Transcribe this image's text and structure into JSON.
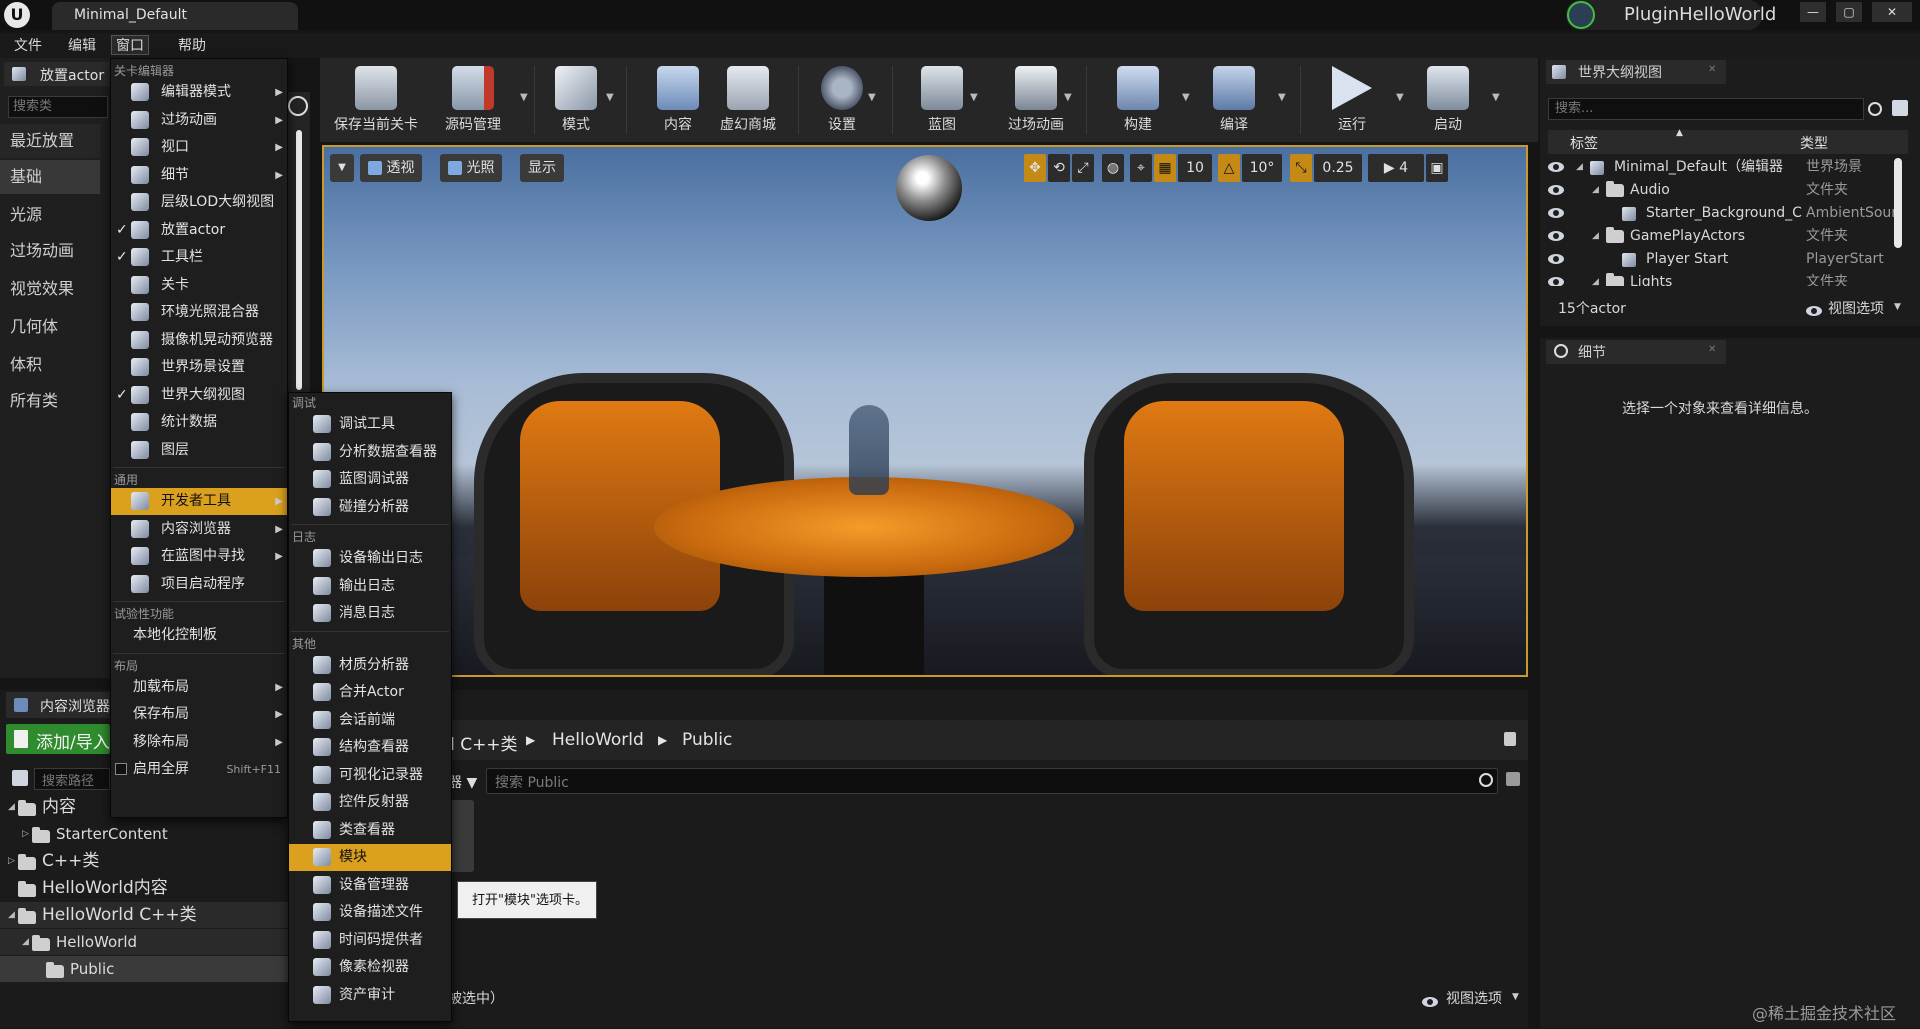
{
  "window": {
    "tab_title": "Minimal_Default",
    "project_name": "PluginHelloWorld",
    "controls": [
      "—",
      "▢",
      "✕"
    ]
  },
  "menubar": {
    "items": [
      {
        "label": "文件"
      },
      {
        "label": "编辑"
      },
      {
        "label": "窗口"
      },
      {
        "label": "帮助"
      }
    ]
  },
  "place_panel": {
    "tab_label": "放置actor",
    "search_placeholder": "搜索类",
    "categories": [
      "最近放置",
      "基础",
      "光源",
      "过场动画",
      "视觉效果",
      "几何体",
      "体积",
      "所有类"
    ]
  },
  "toolbar": {
    "buttons": [
      {
        "label": "保存当前关卡",
        "icon": "save-icon"
      },
      {
        "label": "源码管理",
        "icon": "source-control-icon"
      },
      {
        "label": "模式",
        "icon": "modes-icon"
      },
      {
        "label": "内容",
        "icon": "content-icon"
      },
      {
        "label": "虚幻商城",
        "icon": "marketplace-icon"
      },
      {
        "label": "设置",
        "icon": "settings-icon"
      },
      {
        "label": "蓝图",
        "icon": "blueprint-icon"
      },
      {
        "label": "过场动画",
        "icon": "cinematics-icon"
      },
      {
        "label": "构建",
        "icon": "build-icon"
      },
      {
        "label": "编译",
        "icon": "compile-icon"
      },
      {
        "label": "运行",
        "icon": "play-icon"
      },
      {
        "label": "启动",
        "icon": "launch-icon"
      }
    ]
  },
  "viewport": {
    "perspective": "透视",
    "lit": "光照",
    "show": "显示",
    "grid_snap": "10",
    "rotation_snap": "10°",
    "scale_snap": "0.25",
    "camera_speed": "4"
  },
  "outliner": {
    "tab_label": "世界大纲视图",
    "search_placeholder": "搜索...",
    "col_label": "标签",
    "col_type": "类型",
    "rows": [
      {
        "label": "Minimal_Default（编辑器",
        "type": "世界场景",
        "indent": 0
      },
      {
        "label": "Audio",
        "type": "文件夹",
        "indent": 1
      },
      {
        "label": "Starter_Background_C",
        "type": "AmbientSoun",
        "indent": 2
      },
      {
        "label": "GamePlayActors",
        "type": "文件夹",
        "indent": 1
      },
      {
        "label": "Player Start",
        "type": "PlayerStart",
        "indent": 2
      },
      {
        "label": "Lights",
        "type": "文件夹",
        "indent": 1
      }
    ],
    "actor_count": "15个actor",
    "view_options": "视图选项"
  },
  "details": {
    "tab_label": "细节",
    "empty_message": "选择一个对象来查看详细信息。"
  },
  "content_browser": {
    "tab_label": "内容浏览器",
    "add_import": "添加/导入",
    "path_search_placeholder": "搜索路径",
    "crumbs": [
      "d C++类",
      "HelloWorld",
      "Public"
    ],
    "search_placeholder": "搜索 Public",
    "tree": [
      {
        "label": "内容",
        "indent": 0,
        "kind": "folder"
      },
      {
        "label": "StarterContent",
        "indent": 1,
        "kind": "folder"
      },
      {
        "label": "C++类",
        "indent": 0,
        "kind": "cpp"
      },
      {
        "label": "HelloWorld内容",
        "indent": 0,
        "kind": "folder"
      },
      {
        "label": "HelloWorld C++类",
        "indent": 0,
        "kind": "cpp"
      },
      {
        "label": "HelloWorld",
        "indent": 1,
        "kind": "cpp"
      },
      {
        "label": "Public",
        "indent": 2,
        "kind": "cpp"
      }
    ],
    "status_text": "被选中）",
    "view_options": "视图选项"
  },
  "window_menu": {
    "sections": [
      {
        "heading": "关卡编辑器",
        "items": [
          {
            "label": "编辑器模式",
            "icon": "editor-modes-icon",
            "checked": false,
            "submenu": true
          },
          {
            "label": "过场动画",
            "icon": "cinematics-icon",
            "checked": false,
            "submenu": true
          },
          {
            "label": "视口",
            "icon": "viewport-icon",
            "checked": false,
            "submenu": true
          },
          {
            "label": "细节",
            "icon": "details-icon",
            "checked": false,
            "submenu": true
          },
          {
            "label": "层级LOD大纲视图",
            "icon": "hlod-icon",
            "checked": false,
            "submenu": false
          },
          {
            "label": "放置actor",
            "icon": "place-actor-icon",
            "checked": true,
            "submenu": false
          },
          {
            "label": "工具栏",
            "icon": "toolbar-icon",
            "checked": true,
            "submenu": false
          },
          {
            "label": "关卡",
            "icon": "levels-icon",
            "checked": false,
            "submenu": false
          },
          {
            "label": "环境光照混合器",
            "icon": "env-light-mixer-icon",
            "checked": false,
            "submenu": false
          },
          {
            "label": "摄像机晃动预览器",
            "icon": "camera-shake-icon",
            "checked": false,
            "submenu": false
          },
          {
            "label": "世界场景设置",
            "icon": "world-settings-icon",
            "checked": false,
            "submenu": false
          },
          {
            "label": "世界大纲视图",
            "icon": "world-outliner-icon",
            "checked": true,
            "submenu": false
          },
          {
            "label": "统计数据",
            "icon": "statistics-icon",
            "checked": false,
            "submenu": false
          },
          {
            "label": "图层",
            "icon": "layers-icon",
            "checked": false,
            "submenu": false
          }
        ]
      },
      {
        "heading": "通用",
        "items": [
          {
            "label": "开发者工具",
            "icon": "developer-tools-icon",
            "checked": false,
            "submenu": true,
            "highlighted": true
          },
          {
            "label": "内容浏览器",
            "icon": "content-browser-icon",
            "checked": false,
            "submenu": true
          },
          {
            "label": "在蓝图中寻找",
            "icon": "find-blueprints-icon",
            "checked": false,
            "submenu": true
          },
          {
            "label": "项目启动程序",
            "icon": "project-launcher-icon",
            "checked": false,
            "submenu": false
          }
        ]
      },
      {
        "heading": "试验性功能",
        "items": [
          {
            "label": "本地化控制板",
            "icon": "",
            "checked": false,
            "submenu": false
          }
        ]
      },
      {
        "heading": "布局",
        "items": [
          {
            "label": "加载布局",
            "icon": "",
            "checked": false,
            "submenu": true
          },
          {
            "label": "保存布局",
            "icon": "",
            "checked": false,
            "submenu": true
          },
          {
            "label": "移除布局",
            "icon": "",
            "checked": false,
            "submenu": true
          },
          {
            "label": "启用全屏",
            "icon": "",
            "checked": false,
            "submenu": false,
            "shortcut": "Shift+F11",
            "checkbox": true
          }
        ]
      }
    ]
  },
  "devtools_menu": {
    "sections": [
      {
        "heading": "调试",
        "items": [
          {
            "label": "调试工具",
            "icon": "debug-tools-icon"
          },
          {
            "label": "分析数据查看器",
            "icon": "profiler-icon"
          },
          {
            "label": "蓝图调试器",
            "icon": "blueprint-debugger-icon"
          },
          {
            "label": "碰撞分析器",
            "icon": "collision-analyzer-icon"
          }
        ]
      },
      {
        "heading": "日志",
        "items": [
          {
            "label": "设备输出日志",
            "icon": "device-output-log-icon"
          },
          {
            "label": "输出日志",
            "icon": "output-log-icon"
          },
          {
            "label": "消息日志",
            "icon": "message-log-icon"
          }
        ]
      },
      {
        "heading": "其他",
        "items": [
          {
            "label": "材质分析器",
            "icon": "material-analyzer-icon"
          },
          {
            "label": "合并Actor",
            "icon": "merge-actors-icon"
          },
          {
            "label": "会话前端",
            "icon": "session-frontend-icon"
          },
          {
            "label": "结构查看器",
            "icon": "struct-viewer-icon"
          },
          {
            "label": "可视化记录器",
            "icon": "visual-logger-icon"
          },
          {
            "label": "控件反射器",
            "icon": "widget-reflector-icon"
          },
          {
            "label": "类查看器",
            "icon": "class-viewer-icon"
          },
          {
            "label": "模块",
            "icon": "modules-icon",
            "highlighted": true
          },
          {
            "label": "设备管理器",
            "icon": "device-manager-icon"
          },
          {
            "label": "设备描述文件",
            "icon": "device-profiles-icon"
          },
          {
            "label": "时间码提供者",
            "icon": "timecode-provider-icon"
          },
          {
            "label": "像素检视器",
            "icon": "pixel-inspector-icon"
          },
          {
            "label": "资产审计",
            "icon": "asset-audit-icon"
          }
        ]
      }
    ]
  },
  "tooltip": {
    "text": "打开\"模块\"选项卡。"
  },
  "watermark": "@稀土掘金技术社区",
  "colors": {
    "accent": "#dba01e",
    "viewport_border": "#c79a2e",
    "panel_bg": "#1c1c1c"
  }
}
